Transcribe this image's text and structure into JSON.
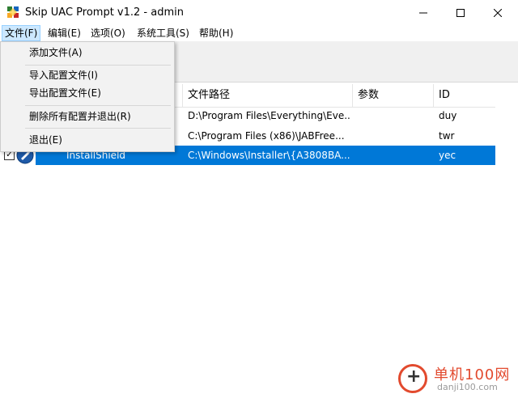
{
  "window": {
    "title": "Skip UAC Prompt v1.2 - admin",
    "app_icon": "skip-uac-app-icon",
    "controls": [
      "minimize-icon",
      "maximize-icon",
      "close-icon"
    ]
  },
  "menubar": {
    "items": [
      {
        "label": "文件(F)",
        "active": true
      },
      {
        "label": "编辑(E)"
      },
      {
        "label": "选项(O)"
      },
      {
        "label": "系统工具(S)"
      },
      {
        "label": "帮助(H)"
      }
    ]
  },
  "file_menu": {
    "items": [
      {
        "label": "添加文件(A)"
      },
      {
        "label": "导入配置文件(I)"
      },
      {
        "label": "导出配置文件(E)"
      },
      {
        "label": "删除所有配置并退出(R)"
      },
      {
        "label": "退出(E)"
      }
    ]
  },
  "list": {
    "headers": {
      "path": "文件路径",
      "params": "参数",
      "id": "ID"
    },
    "rows": [
      {
        "name": "",
        "path": "D:\\Program Files\\Everything\\Eve...",
        "params": "",
        "id": "duy"
      },
      {
        "name": "",
        "path": "C:\\Program Files (x86)\\JABFree...",
        "params": "",
        "id": "twr"
      },
      {
        "name": "InstallShield",
        "path": "C:\\Windows\\Installer\\{A3808BA...",
        "params": "",
        "id": "yec",
        "checked": true,
        "selected": true
      }
    ]
  },
  "watermark": {
    "title": "单机100网",
    "url": "danji100.com"
  },
  "colors": {
    "selection": "#0078d7",
    "menu_active": "#cce8ff",
    "watermark_red": "#e24a2e"
  }
}
